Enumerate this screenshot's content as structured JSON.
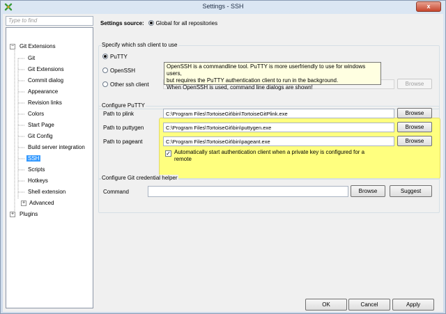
{
  "window": {
    "title": "Settings - SSH",
    "close_glyph": "x"
  },
  "search": {
    "placeholder": "Type to find"
  },
  "tree": {
    "root": "Git Extensions",
    "items": [
      "Git",
      "Git Extensions",
      "Commit dialog",
      "Appearance",
      "Revision links",
      "Colors",
      "Start Page",
      "Git Config",
      "Build server integration",
      "SSH",
      "Scripts",
      "Hotkeys",
      "Shell extension",
      "Advanced"
    ],
    "selected": "SSH",
    "plugins": "Plugins"
  },
  "settings_source": {
    "label": "Settings source:",
    "option": "Global for all repositories"
  },
  "ssh_client": {
    "group_title": "Specify which ssh client to use",
    "putty": "PuTTY",
    "openssh": "OpenSSH",
    "other": "Other ssh client",
    "browse": "Browse",
    "tooltip": "OpenSSH is a commandline tool. PuTTY is more userfriendly to use for windows users,\nbut requires the PuTTY authentication client to run  in the background.\nWhen OpenSSH is used, command line dialogs are shown!"
  },
  "putty_config": {
    "group_title": "Configure PuTTY",
    "plink_label": "Path to plink",
    "plink_value": "C:\\Program Files\\TortoiseGit\\bin\\TortoiseGitPlink.exe",
    "puttygen_label": "Path to puttygen",
    "puttygen_value": "C:\\Program Files\\TortoiseGit\\bin\\puttygen.exe",
    "pageant_label": "Path to pageant",
    "pageant_value": "C:\\Program Files\\TortoiseGit\\bin\\pageant.exe",
    "browse": "Browse",
    "auto_start": "Automatically start authentication client when a private key is configured for a remote",
    "auto_start_checked": true
  },
  "credential_helper": {
    "group_title": "Configure Git credential helper",
    "command_label": "Command",
    "command_value": "",
    "browse": "Browse",
    "suggest": "Suggest"
  },
  "footer": {
    "ok": "OK",
    "cancel": "Cancel",
    "apply": "Apply"
  },
  "colors": {
    "highlight": "#ffff7f",
    "selection": "#3399ff",
    "tooltip_bg": "#ffffe1"
  }
}
